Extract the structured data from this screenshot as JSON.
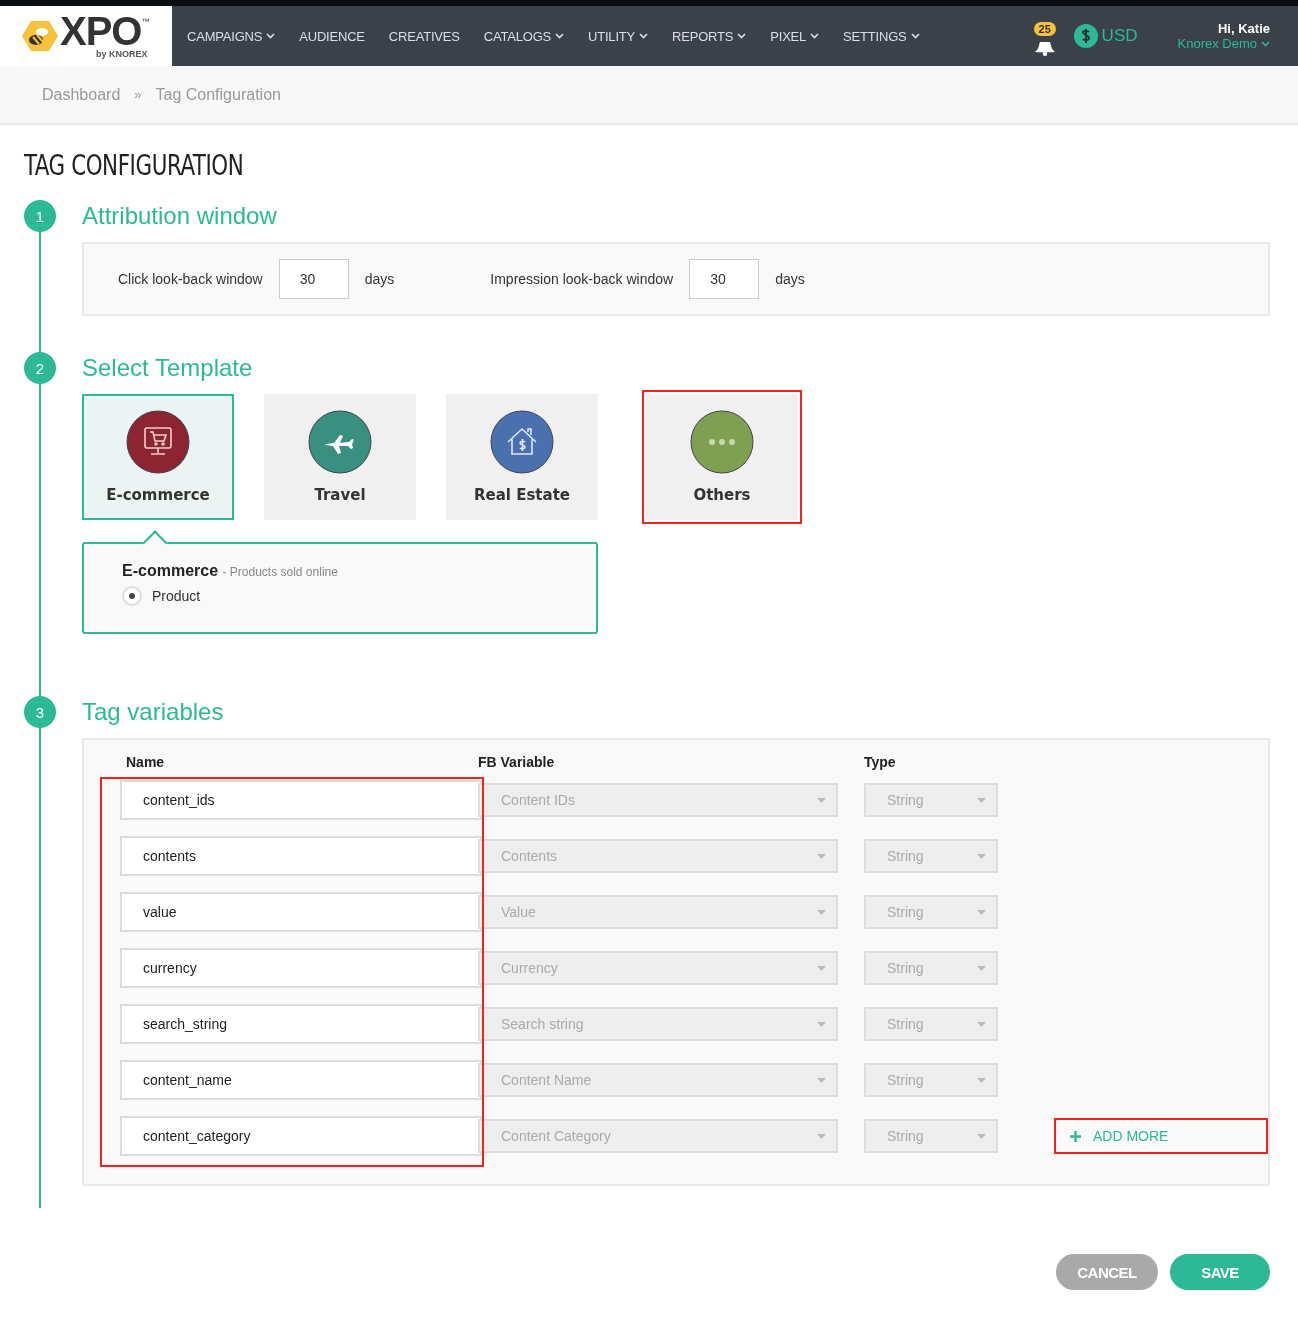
{
  "header": {
    "logo": {
      "text": "XPO",
      "tm": "™",
      "byline": "by KNOREX"
    },
    "nav": [
      {
        "label": "CAMPAIGNS",
        "dropdown": true
      },
      {
        "label": "AUDIENCE",
        "dropdown": false
      },
      {
        "label": "CREATIVES",
        "dropdown": false
      },
      {
        "label": "CATALOGS",
        "dropdown": true
      },
      {
        "label": "UTILITY",
        "dropdown": true
      },
      {
        "label": "REPORTS",
        "dropdown": true
      },
      {
        "label": "PIXEL",
        "dropdown": true
      },
      {
        "label": "SETTINGS",
        "dropdown": true
      }
    ],
    "notifications": "25",
    "currency": "USD",
    "greeting": "Hi, Katie",
    "account": "Knorex Demo"
  },
  "breadcrumb": [
    "Dashboard",
    "Tag Configuration"
  ],
  "breadcrumb_separator": "»",
  "page_title": "TAG CONFIGURATION",
  "steps": [
    {
      "number": "1",
      "title": "Attribution window"
    },
    {
      "number": "2",
      "title": "Select Template"
    },
    {
      "number": "3",
      "title": "Tag variables"
    }
  ],
  "attribution": [
    {
      "label": "Click look-back window",
      "value": "30",
      "unit": "days"
    },
    {
      "label": "Impression look-back window",
      "value": "30",
      "unit": "days"
    }
  ],
  "templates": [
    {
      "label": "E-commerce",
      "kind": "cart",
      "color": "#8c2432",
      "selected": true,
      "highlighted": false
    },
    {
      "label": "Travel",
      "kind": "plane",
      "color": "#3a9080",
      "selected": false,
      "highlighted": false
    },
    {
      "label": "Real Estate",
      "kind": "house",
      "color": "#4a70ae",
      "selected": false,
      "highlighted": false
    },
    {
      "label": "Others",
      "kind": "dots",
      "color": "#7ea050",
      "selected": false,
      "highlighted": true
    }
  ],
  "template_detail": {
    "title": "E-commerce",
    "description": "- Products sold online",
    "options": [
      {
        "label": "Product",
        "selected": true
      }
    ]
  },
  "variables": {
    "columns": [
      "Name",
      "FB Variable",
      "Type"
    ],
    "name_column_highlighted": true,
    "rows": [
      {
        "name": "content_ids",
        "fb_variable": "Content IDs",
        "type": "String"
      },
      {
        "name": "contents",
        "fb_variable": "Contents",
        "type": "String"
      },
      {
        "name": "value",
        "fb_variable": "Value",
        "type": "String"
      },
      {
        "name": "currency",
        "fb_variable": "Currency",
        "type": "String"
      },
      {
        "name": "search_string",
        "fb_variable": "Search string",
        "type": "String"
      },
      {
        "name": "content_name",
        "fb_variable": "Content Name",
        "type": "String"
      },
      {
        "name": "content_category",
        "fb_variable": "Content Category",
        "type": "String"
      }
    ],
    "add_more": {
      "label": "ADD MORE",
      "highlighted": true
    }
  },
  "buttons": [
    {
      "label": "CANCEL",
      "kind": "secondary"
    },
    {
      "label": "SAVE",
      "kind": "primary"
    }
  ]
}
